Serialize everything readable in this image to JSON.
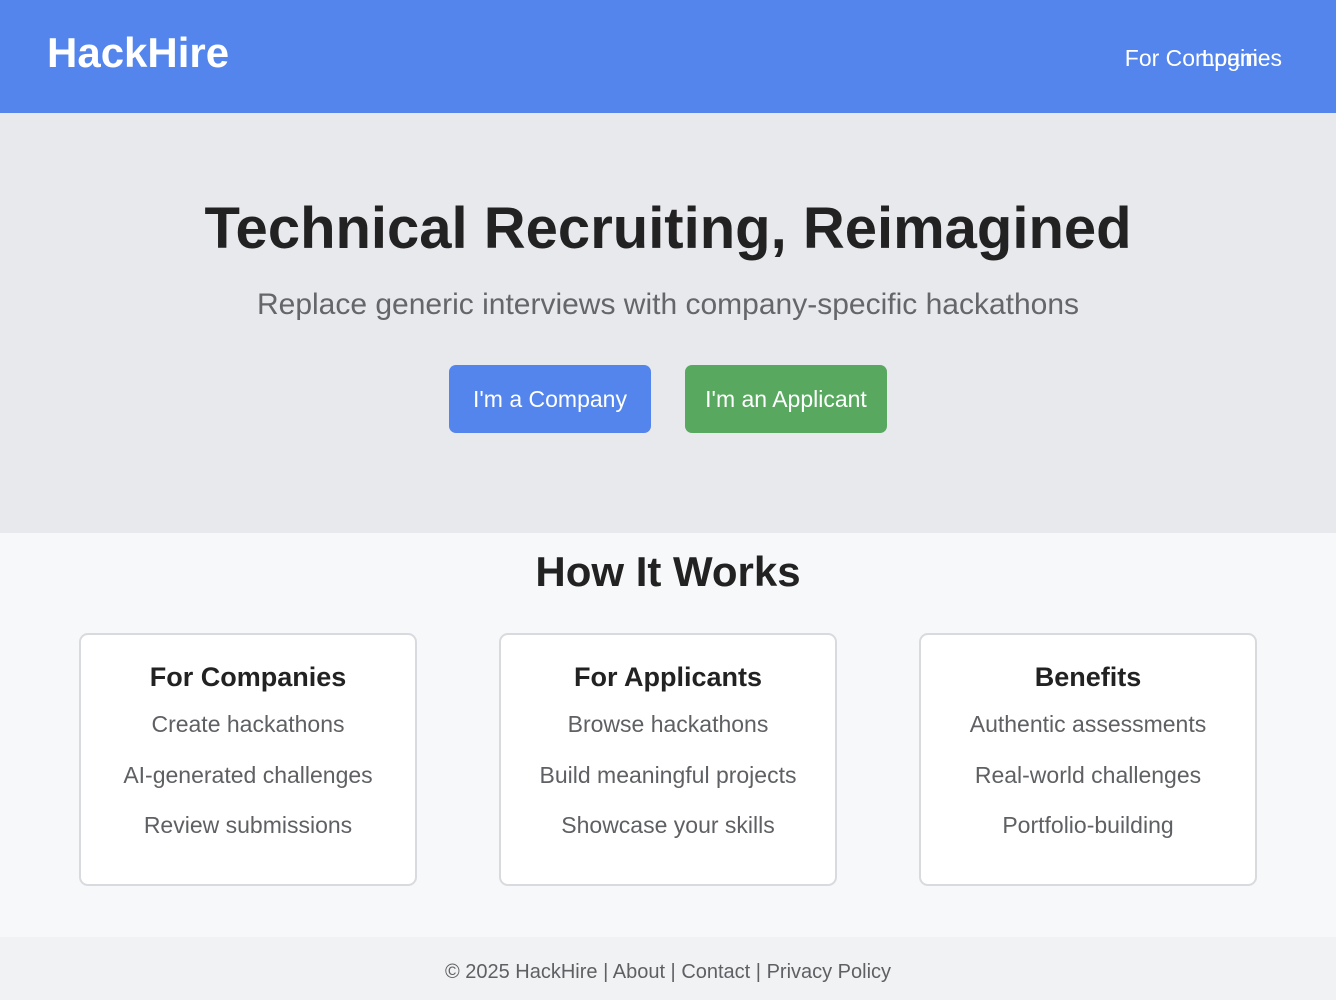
{
  "brand": {
    "name": "HackHire",
    "primary": "#5385ed",
    "success": "#58a85f"
  },
  "nav": {
    "companies_label": "For Companies",
    "login_label": "Login"
  },
  "hero": {
    "title": "Technical Recruiting, Reimagined",
    "subtitle": "Replace generic interviews with company-specific hackathons",
    "company_button": "I'm a Company",
    "applicant_button": "I'm an Applicant"
  },
  "how": {
    "title": "How It Works",
    "cards": [
      {
        "title": "For Companies",
        "items": [
          "Create hackathons",
          "AI-generated challenges",
          "Review submissions"
        ]
      },
      {
        "title": "For Applicants",
        "items": [
          "Browse hackathons",
          "Build meaningful projects",
          "Showcase your skills"
        ]
      },
      {
        "title": "Benefits",
        "items": [
          "Authentic assessments",
          "Real-world challenges",
          "Portfolio-building"
        ]
      }
    ]
  },
  "footer": {
    "copyright": "© 2025 HackHire",
    "separator": " | ",
    "links": [
      "About",
      "Contact",
      "Privacy Policy"
    ]
  }
}
